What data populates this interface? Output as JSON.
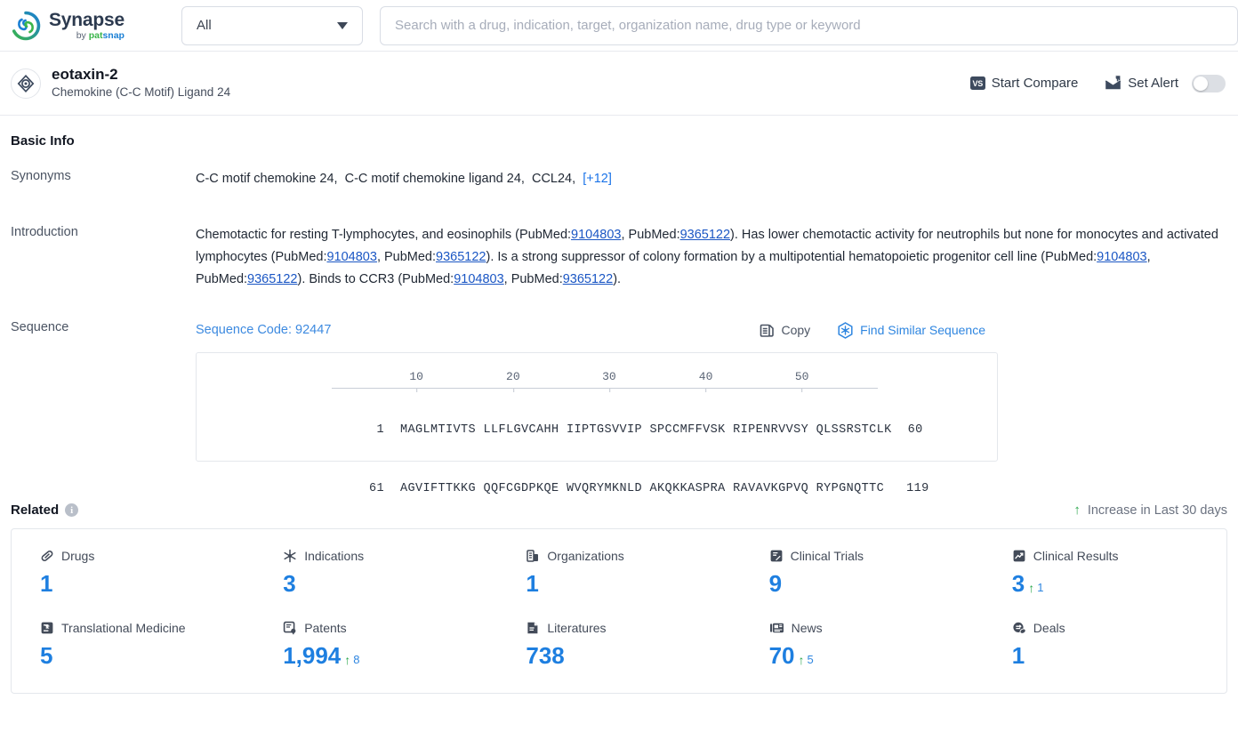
{
  "topbar": {
    "logo": {
      "title": "Synapse",
      "by": "by ",
      "pat": "pat",
      "snap": "snap"
    },
    "scope": {
      "value": "All",
      "icon": "chevron-down-icon"
    },
    "search": {
      "placeholder": "Search with a drug, indication, target, organization name, drug type or keyword",
      "value": ""
    }
  },
  "entity": {
    "icon": "target-icon",
    "title": "eotaxin-2",
    "subtitle": "Chemokine (C-C Motif) Ligand 24",
    "actions": {
      "compare_badge": "VS",
      "compare_label": "Start Compare",
      "alert_label": "Set Alert",
      "alert_toggle_on": false
    }
  },
  "basic_info": {
    "title": "Basic Info",
    "synonyms": {
      "label": "Synonyms",
      "items": [
        "C-C motif chemokine 24",
        "C-C motif chemokine ligand 24",
        "CCL24"
      ],
      "more": "[+12]"
    },
    "introduction": {
      "label": "Introduction",
      "text_parts": [
        "Chemotactic for resting T-lymphocytes, and eosinophils (PubMed:",
        "9104803",
        ", PubMed:",
        "9365122",
        "). Has lower chemotactic activity for neutrophils but none for monocytes and activated lymphocytes (PubMed:",
        "9104803",
        ", PubMed:",
        "9365122",
        "). Is a strong suppressor of colony formation by a multipotential hematopoietic progenitor cell line (PubMed:",
        "9104803",
        ", PubMed:",
        "9365122",
        "). Binds to CCR3 (PubMed:",
        "9104803",
        ", PubMed:",
        "9365122",
        ")."
      ]
    },
    "sequence": {
      "label": "Sequence",
      "code_label": "Sequence Code: 92447",
      "copy_label": "Copy",
      "copy_icon": "copy-icon",
      "similar_label": "Find Similar Sequence",
      "similar_icon": "find-similar-sequence-icon",
      "ruler_ticks": [
        "10",
        "20",
        "30",
        "40",
        "50"
      ],
      "rows": [
        {
          "start": "1",
          "blocks": "MAGLMTIVTS LLFLGVCAHH IIPTGSVVIP SPCCMFFVSK RIPENRVVSY QLSSRSTCLK",
          "end": "60"
        },
        {
          "start": "61",
          "blocks": "AGVIFTTKKG QQFCGDPKQE WVQRYMKNLD AKQKKASPRA RAVAVKGPVQ RYPGNQTTC",
          "end": "119"
        }
      ]
    }
  },
  "related": {
    "title": "Related",
    "info_icon": "info-icon",
    "legend": {
      "arrow": "↑",
      "text": "Increase in Last 30 days"
    },
    "stats": [
      {
        "icon": "pill-icon",
        "label": "Drugs",
        "value": "1",
        "delta": ""
      },
      {
        "icon": "snowflake-icon",
        "label": "Indications",
        "value": "3",
        "delta": ""
      },
      {
        "icon": "building-icon",
        "label": "Organizations",
        "value": "1",
        "delta": ""
      },
      {
        "icon": "clinical-trial-icon",
        "label": "Clinical Trials",
        "value": "9",
        "delta": ""
      },
      {
        "icon": "clinical-result-icon",
        "label": "Clinical Results",
        "value": "3",
        "delta": "1"
      },
      {
        "icon": "translational-icon",
        "label": "Translational Medicine",
        "value": "5",
        "delta": ""
      },
      {
        "icon": "patent-icon",
        "label": "Patents",
        "value": "1,994",
        "delta": "8"
      },
      {
        "icon": "literature-icon",
        "label": "Literatures",
        "value": "738",
        "delta": ""
      },
      {
        "icon": "news-icon",
        "label": "News",
        "value": "70",
        "delta": "5"
      },
      {
        "icon": "deal-icon",
        "label": "Deals",
        "value": "1",
        "delta": ""
      }
    ]
  },
  "colors": {
    "accent_blue": "#1e7fe0",
    "link_blue": "#1a73e8",
    "increase_green": "#2fa84f",
    "logo_green": "#3ab54a",
    "logo_blue": "#1a7fd4"
  }
}
